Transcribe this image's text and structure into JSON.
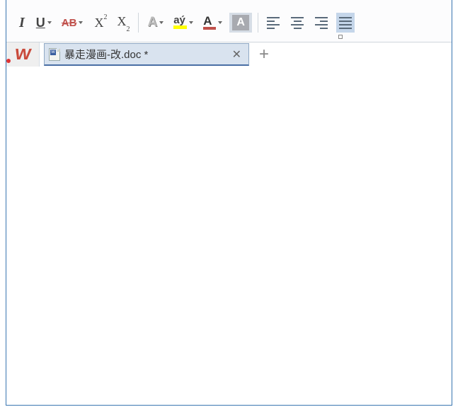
{
  "toolbar": {
    "italic": "I",
    "underline": "U",
    "strike": "AB",
    "superscript_x": "X",
    "superscript_n": "2",
    "subscript_x": "X",
    "subscript_n": "2",
    "texteffect": "A",
    "highlight_label": "aý",
    "fontcolor": "A",
    "shading": "A",
    "highlight_color": "#ffff00",
    "fontcolor_swatch": "#c0504b"
  },
  "tabs": {
    "home_logo": "W",
    "doc_icon_badge": "W",
    "active_doc": "暴走漫画-改.doc *",
    "close": "✕",
    "add": "+"
  }
}
